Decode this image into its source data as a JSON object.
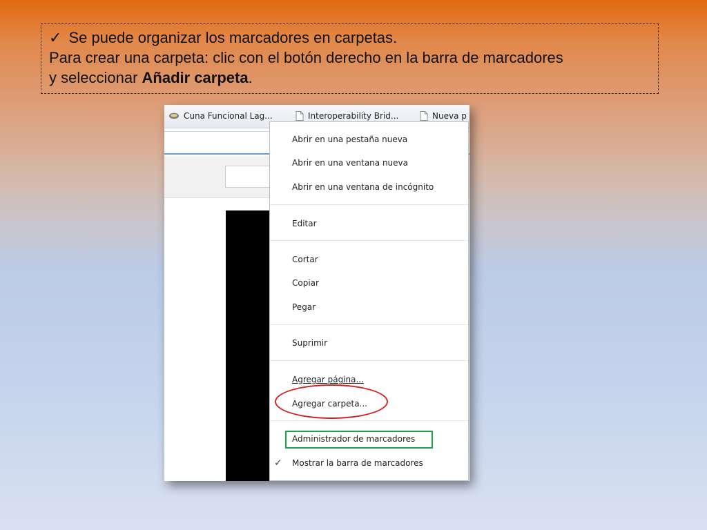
{
  "callout": {
    "check": "✓",
    "line1": "Se puede organizar los marcadores en carpetas.",
    "line2": "Para crear una carpeta: clic con el botón derecho en la barra de marcadores",
    "line3_prefix": "y seleccionar ",
    "line3_bold": "Añadir carpeta",
    "line3_suffix": "."
  },
  "bookmarks_bar": {
    "items": [
      {
        "label": "Cuna Funcional Lag...",
        "icon": "site-favicon-icon"
      },
      {
        "label": "Interoperability Brid...",
        "icon": "page-icon"
      },
      {
        "label": "Nueva p",
        "icon": "page-icon"
      }
    ]
  },
  "context_menu": {
    "open_new_tab": "Abrir en una pestaña nueva",
    "open_new_window": "Abrir en una ventana nueva",
    "open_incognito": "Abrir en una ventana de incógnito",
    "edit": "Editar",
    "cut": "Cortar",
    "copy": "Copiar",
    "paste": "Pegar",
    "delete": "Suprimir",
    "add_page": "Agregar página...",
    "add_folder": "Agregar carpeta...",
    "bookmark_manager": "Administrador de marcadores",
    "show_bookmarks_bar": "Mostrar la barra de marcadores",
    "show_bar_checked_mark": "✓"
  },
  "colors": {
    "highlight_ellipse": "#d42020",
    "highlight_box": "#1aa34a"
  }
}
